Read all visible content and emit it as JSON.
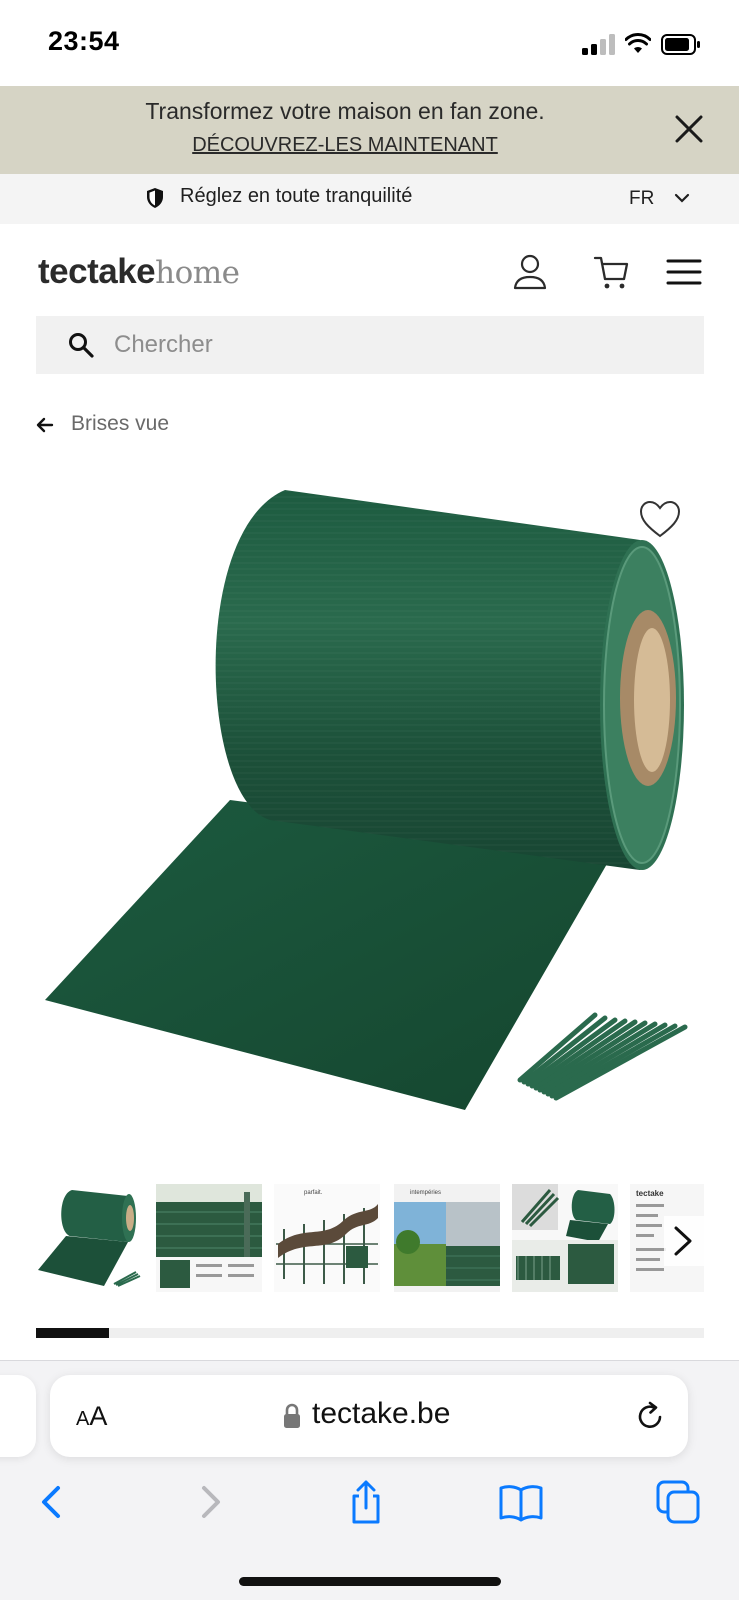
{
  "status_bar": {
    "time": "23:54"
  },
  "promo": {
    "title": "Transformez votre maison en fan zone.",
    "link": "DÉCOUVREZ-LES MAINTENANT",
    "close_icon": "close-icon"
  },
  "trust_bar": {
    "text": "Réglez en toute tranquilité",
    "language": "FR"
  },
  "header": {
    "logo_strong": "tectake",
    "logo_light": "home",
    "icons": [
      "account-icon",
      "cart-icon",
      "menu-icon"
    ]
  },
  "search": {
    "placeholder": "Chercher"
  },
  "breadcrumb": {
    "label": "Brises vue"
  },
  "gallery": {
    "thumbnail_count": 6,
    "active_index": 0,
    "progress": 0.11,
    "thumb_texts": {
      "t3_caption": "parfait.",
      "t4_caption": "intempéries",
      "t6_caption": "tectake"
    }
  },
  "browser": {
    "url": "tectake.be",
    "aa_label_small": "A",
    "aa_label_big": "A"
  },
  "colors": {
    "promo_bg": "#d6d4c5",
    "product_green": "#1f5a3f",
    "accent_blue": "#0a7aff"
  }
}
